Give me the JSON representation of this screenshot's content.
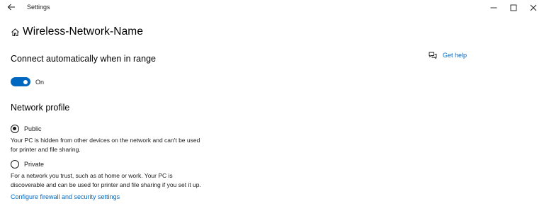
{
  "window": {
    "app_title": "Settings"
  },
  "header": {
    "page_title": "Wireless-Network-Name"
  },
  "help": {
    "label": "Get help"
  },
  "connect_section": {
    "heading": "Connect automatically when in range",
    "toggle_state_label": "On",
    "toggle_on": true
  },
  "profile_section": {
    "heading": "Network profile",
    "options": [
      {
        "label": "Public",
        "selected": true,
        "description_lines": [
          "Your PC is hidden from other devices on the network and can't be used",
          "for printer and file sharing."
        ]
      },
      {
        "label": "Private",
        "selected": false,
        "description_lines": [
          "For a network you trust, such as at home or work. Your PC is",
          "discoverable and can be used for printer and file sharing if you set it up."
        ]
      }
    ],
    "firewall_link": "Configure firewall and security settings"
  },
  "colors": {
    "accent": "#0067c0",
    "text": "#1a1a1a",
    "background": "#ffffff"
  },
  "icons": {
    "back": "back-arrow-icon",
    "home": "home-icon",
    "help": "chat-help-icon",
    "minimize": "minimize-icon",
    "maximize": "maximize-icon",
    "close": "close-icon"
  }
}
